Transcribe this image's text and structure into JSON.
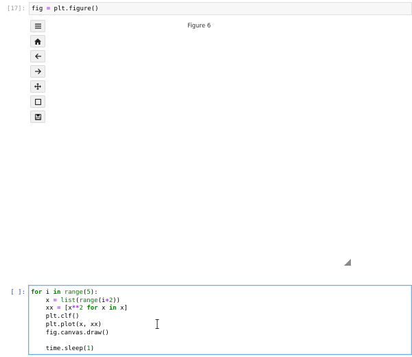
{
  "cell1": {
    "prompt": "[17]:",
    "code": "fig = plt.figure()"
  },
  "figure": {
    "title": "Figure 6",
    "toolbar": [
      {
        "icon": "menu-icon"
      },
      {
        "icon": "home-icon"
      },
      {
        "icon": "back-arrow-icon"
      },
      {
        "icon": "forward-arrow-icon"
      },
      {
        "icon": "pan-icon"
      },
      {
        "icon": "zoom-rect-icon"
      },
      {
        "icon": "save-icon"
      }
    ]
  },
  "cell2": {
    "prompt": "[ ]:",
    "lines": [
      "for i in range(5):",
      "    x = list(range(i+2))",
      "    xx = [x**2 for x in x]",
      "    plt.clf()",
      "    plt.plot(x, xx)",
      "    fig.canvas.draw()",
      "",
      "    time.sleep(1)"
    ]
  },
  "colors": {
    "prompt_in": "#303f9f",
    "prompt_done": "#9e9e9e",
    "active_border": "#66afe9",
    "keyword": "#008000",
    "operator": "#aa22ff"
  }
}
